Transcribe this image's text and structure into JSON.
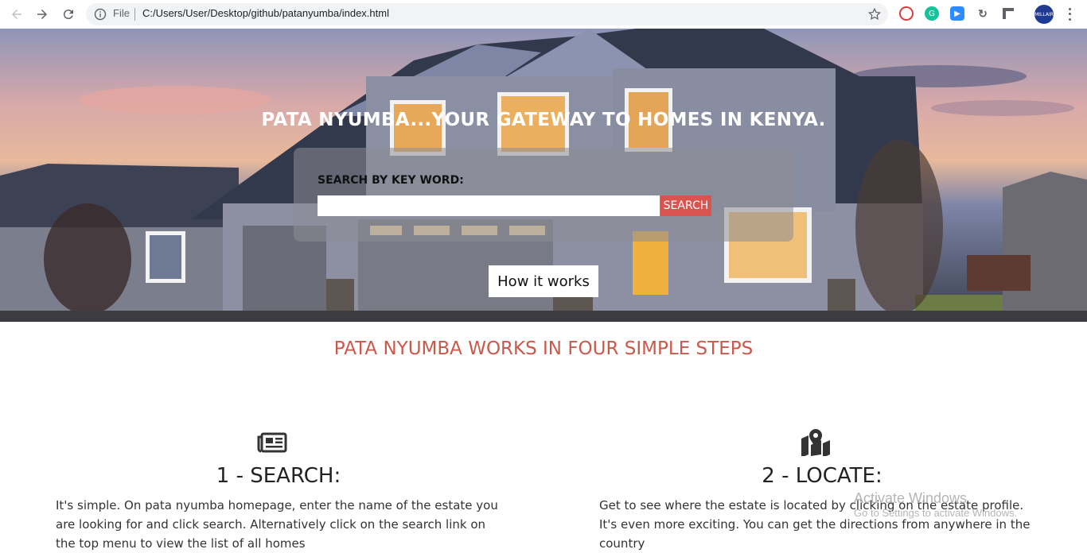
{
  "browser": {
    "protocol_label": "File",
    "url": "C:/Users/User/Desktop/github/patanyumba/index.html",
    "profile_initials": "MILLAIR",
    "extensions": [
      "lastpass-icon",
      "grammarly-icon",
      "zoom-icon",
      "refresh-ext-icon",
      "extension-icon"
    ]
  },
  "hero": {
    "title": "PATA NYUMBA...YOUR GATEWAY TO HOMES IN KENYA.",
    "search_label": "SEARCH BY KEY WORD:",
    "search_value": "",
    "search_button": "SEARCH",
    "how_button": "How it works"
  },
  "main": {
    "heading": "PATA NYUMBA WORKS IN FOUR SIMPLE STEPS",
    "steps": [
      {
        "icon": "newspaper-icon",
        "title": "1 - SEARCH:",
        "text": "It's simple. On pata nyumba homepage, enter the name of the estate you are looking for and click search. Alternatively click on the search link on the top menu to view the list of all homes"
      },
      {
        "icon": "map-location-icon",
        "title": "2 - LOCATE:",
        "text": "Get to see where the estate is located by clicking on the estate profile. It's even more exciting. You can get the directions from anywhere in the country"
      }
    ]
  },
  "watermark": {
    "line1": "Activate Windows",
    "line2": "Go to Settings to activate Windows."
  },
  "colors": {
    "accent": "#d9534f",
    "heading": "#c9594a"
  }
}
